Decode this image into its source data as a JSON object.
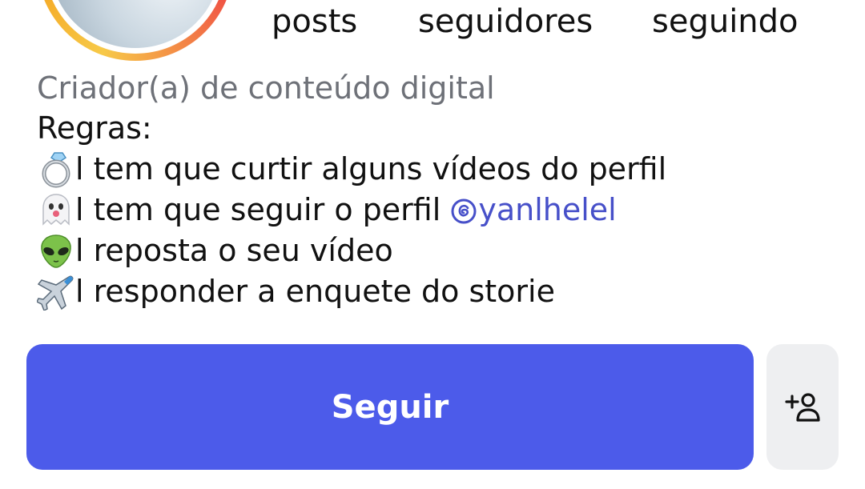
{
  "profile": {
    "stats": {
      "posts_label": "posts",
      "followers_label": "seguidores",
      "following_label": "seguindo"
    },
    "category": "Criador(a) de conteúdo digital",
    "bio": {
      "header": "Regras:",
      "lines": [
        {
          "icon": "ring-emoji",
          "text": "l tem que curtir alguns vídeos do perfil"
        },
        {
          "icon": "ghost-emoji",
          "text": "l tem que seguir o perfil ",
          "mention": "yanlhelel",
          "mention_icon": "threads-icon"
        },
        {
          "icon": "alien-emoji",
          "text": "l reposta o seu vídeo"
        },
        {
          "icon": "airplane-emoji",
          "text": "l responder a enquete do storie"
        }
      ]
    },
    "actions": {
      "follow_label": "Seguir",
      "add_user_icon": "add-user-icon"
    },
    "colors": {
      "follow_button": "#4c5bea",
      "mention": "#4750c9",
      "category_text": "#6e7178",
      "secondary_button": "#eeeff1"
    }
  }
}
